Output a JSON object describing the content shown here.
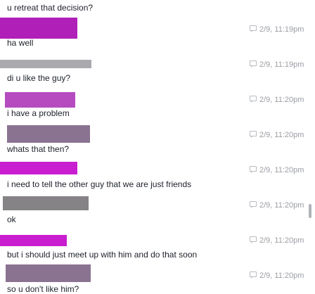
{
  "messages": [
    {
      "text": "u retreat that decision?",
      "timestamp": "",
      "sender_bar_color": ""
    },
    {
      "text": "ha well",
      "timestamp": "2/9, 11:19pm",
      "sender_bar_color": "#b01fb8"
    },
    {
      "text": "di u like the guy?",
      "timestamp": "2/9, 11:19pm",
      "sender_bar_color": "#a9a9ae"
    },
    {
      "text": "i have a problem",
      "timestamp": "2/9, 11:20pm",
      "sender_bar_color": "#b54bbf"
    },
    {
      "text": "whats that then?",
      "timestamp": "2/9, 11:20pm",
      "sender_bar_color": "#8a7390"
    },
    {
      "text": "i need to tell the other guy that we are just friends",
      "timestamp": "2/9, 11:20pm",
      "sender_bar_color": "#c81ed0"
    },
    {
      "text": "ok",
      "timestamp": "2/9, 11:20pm",
      "sender_bar_color": "#858385"
    },
    {
      "text": "but i should just meet up with him and do that soon",
      "timestamp": "2/9, 11:20pm",
      "sender_bar_color": "#c81ed0"
    },
    {
      "text": "so u don't like him?",
      "timestamp": "2/9, 11:20pm",
      "sender_bar_color": "#8a7390"
    }
  ],
  "timestamp_icon": "message-bubble-icon"
}
